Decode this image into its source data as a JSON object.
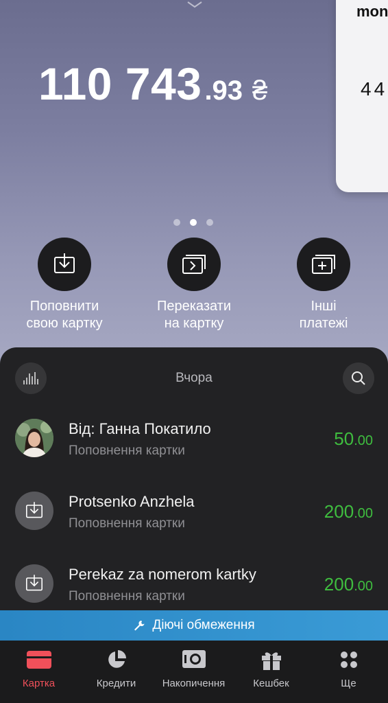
{
  "balance": {
    "integer": "110 743",
    "decimal": ".93",
    "currency": "₴"
  },
  "side_card": {
    "brand": "mon",
    "number": "44"
  },
  "carousel": {
    "pages": 3,
    "active": 1
  },
  "actions": [
    {
      "line1": "Поповнити",
      "line2": "свою картку",
      "icon": "download-icon"
    },
    {
      "line1": "Переказати",
      "line2": "на картку",
      "icon": "transfer-card-icon"
    },
    {
      "line1": "Інші",
      "line2": "платежі",
      "icon": "add-card-icon"
    }
  ],
  "feed": {
    "title": "Вчора",
    "transactions": [
      {
        "title": "Від: Ганна Покатило",
        "subtitle": "Поповнення картки",
        "amount_int": "50",
        "amount_dec": ".00",
        "icon": "avatar"
      },
      {
        "title": "Protsenko Anzhela",
        "subtitle": "Поповнення картки",
        "amount_int": "200",
        "amount_dec": ".00",
        "icon": "download-icon"
      },
      {
        "title": "Perekaz za nomerom kartky",
        "subtitle": "Поповнення картки",
        "amount_int": "200",
        "amount_dec": ".00",
        "icon": "download-icon"
      }
    ]
  },
  "notice": {
    "label": "Діючі обмеження",
    "icon": "wrench-icon"
  },
  "tabs": [
    {
      "label": "Картка",
      "icon": "card-icon",
      "active": true
    },
    {
      "label": "Кредити",
      "icon": "pie-chart-icon",
      "active": false
    },
    {
      "label": "Накопичення",
      "icon": "savings-icon",
      "active": false
    },
    {
      "label": "Кешбек",
      "icon": "gift-icon",
      "active": false
    },
    {
      "label": "Ще",
      "icon": "more-dots-icon",
      "active": false
    }
  ],
  "colors": {
    "accent_green": "#3fbd3f",
    "active_tab": "#f0505a",
    "notice_blue": "#2a86c4"
  }
}
